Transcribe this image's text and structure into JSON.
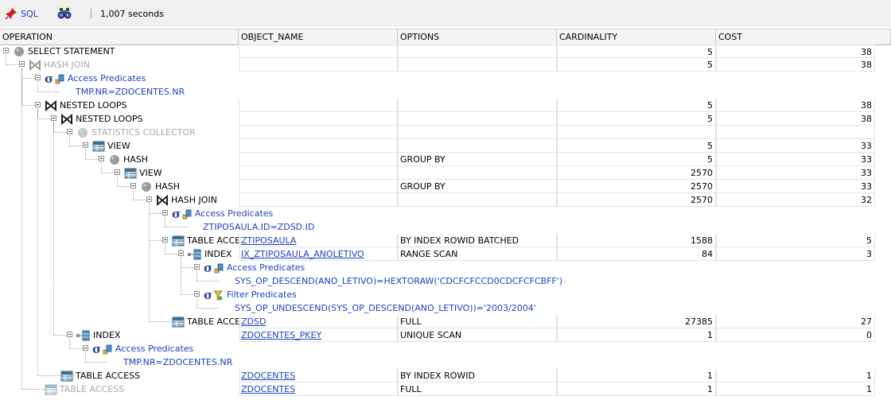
{
  "toolbar": {
    "sql_label": "SQL",
    "elapsed": "1,007 seconds"
  },
  "grid": {
    "columns": [
      "OPERATION",
      "OBJECT_NAME",
      "OPTIONS",
      "CARDINALITY",
      "COST"
    ],
    "rows": [
      {
        "label": "SELECT STATEMENT",
        "icon": "circle-icon",
        "object": "",
        "options": "",
        "cardinality": "5",
        "cost": "38"
      },
      {
        "label": "HASH JOIN",
        "icon": "join-icon",
        "object": "",
        "options": "",
        "cardinality": "5",
        "cost": "38"
      },
      {
        "label": "Access Predicates",
        "icon": "sigma-icon",
        "object": "",
        "options": "",
        "cardinality": "",
        "cost": ""
      },
      {
        "label": "TMP.NR=ZDOCENTES.NR",
        "icon": "",
        "object": "",
        "options": "",
        "cardinality": "",
        "cost": ""
      },
      {
        "label": "NESTED LOOPS",
        "icon": "join-icon",
        "object": "",
        "options": "",
        "cardinality": "5",
        "cost": "38"
      },
      {
        "label": "NESTED LOOPS",
        "icon": "join-icon",
        "object": "",
        "options": "",
        "cardinality": "5",
        "cost": "38"
      },
      {
        "label": "STATISTICS COLLECTOR",
        "icon": "circle-icon",
        "object": "",
        "options": "",
        "cardinality": "",
        "cost": ""
      },
      {
        "label": "VIEW",
        "icon": "table-icon",
        "object": "",
        "options": "",
        "cardinality": "5",
        "cost": "33"
      },
      {
        "label": "HASH",
        "icon": "circle-icon",
        "object": "",
        "options": "GROUP BY",
        "cardinality": "5",
        "cost": "33"
      },
      {
        "label": "VIEW",
        "icon": "table-icon",
        "object": "",
        "options": "",
        "cardinality": "2570",
        "cost": "33"
      },
      {
        "label": "HASH",
        "icon": "circle-icon",
        "object": "",
        "options": "GROUP BY",
        "cardinality": "2570",
        "cost": "33"
      },
      {
        "label": "HASH JOIN",
        "icon": "join-icon",
        "object": "",
        "options": "",
        "cardinality": "2570",
        "cost": "32"
      },
      {
        "label": "Access Predicates",
        "icon": "sigma-icon",
        "object": "",
        "options": "",
        "cardinality": "",
        "cost": ""
      },
      {
        "label": "ZTIPOSAULA.ID=ZDSD.ID",
        "icon": "",
        "object": "",
        "options": "",
        "cardinality": "",
        "cost": ""
      },
      {
        "label": "TABLE ACCE",
        "icon": "table-icon",
        "object": "ZTIPOSAULA",
        "options": "BY INDEX ROWID BATCHED",
        "cardinality": "1588",
        "cost": "5"
      },
      {
        "label": "INDEX",
        "icon": "index-icon",
        "object": "IX_ZTIPOSAULA_ANOLETIVO",
        "options": "RANGE SCAN",
        "cardinality": "84",
        "cost": "3"
      },
      {
        "label": "Access Predicates",
        "icon": "sigma-icon",
        "object": "",
        "options": "",
        "cardinality": "",
        "cost": ""
      },
      {
        "label": "SYS_OP_DESCEND(ANO_LETIVO)=HEXTORAW('CDCFCFCCD0CDCFCFCBFF')",
        "icon": "",
        "object": "",
        "options": "",
        "cardinality": "",
        "cost": ""
      },
      {
        "label": "Filter Predicates",
        "icon": "filter-icon",
        "object": "",
        "options": "",
        "cardinality": "",
        "cost": ""
      },
      {
        "label": "SYS_OP_UNDESCEND(SYS_OP_DESCEND(ANO_LETIVO))='2003/2004'",
        "icon": "",
        "object": "",
        "options": "",
        "cardinality": "",
        "cost": ""
      },
      {
        "label": "TABLE ACCE",
        "icon": "table-icon",
        "object": "ZDSD",
        "options": "FULL",
        "cardinality": "27385",
        "cost": "27"
      },
      {
        "label": "INDEX",
        "icon": "index-icon",
        "object": "ZDOCENTES_PKEY",
        "options": "UNIQUE SCAN",
        "cardinality": "1",
        "cost": "0"
      },
      {
        "label": "Access Predicates",
        "icon": "sigma-icon",
        "object": "",
        "options": "",
        "cardinality": "",
        "cost": ""
      },
      {
        "label": "TMP.NR=ZDOCENTES.NR",
        "icon": "",
        "object": "",
        "options": "",
        "cardinality": "",
        "cost": ""
      },
      {
        "label": "TABLE ACCESS",
        "icon": "table-icon",
        "object": "ZDOCENTES",
        "options": "BY INDEX ROWID",
        "cardinality": "1",
        "cost": "1"
      },
      {
        "label": "TABLE ACCESS",
        "icon": "table-icon",
        "object": "ZDOCENTES",
        "options": "FULL",
        "cardinality": "1",
        "cost": "1"
      }
    ]
  },
  "colors": {
    "link": "#1f3fbf",
    "inactive": "#a8a8a8",
    "header_bg": "#f4f4f4",
    "toolbar_bg": "#f0f0f0"
  }
}
